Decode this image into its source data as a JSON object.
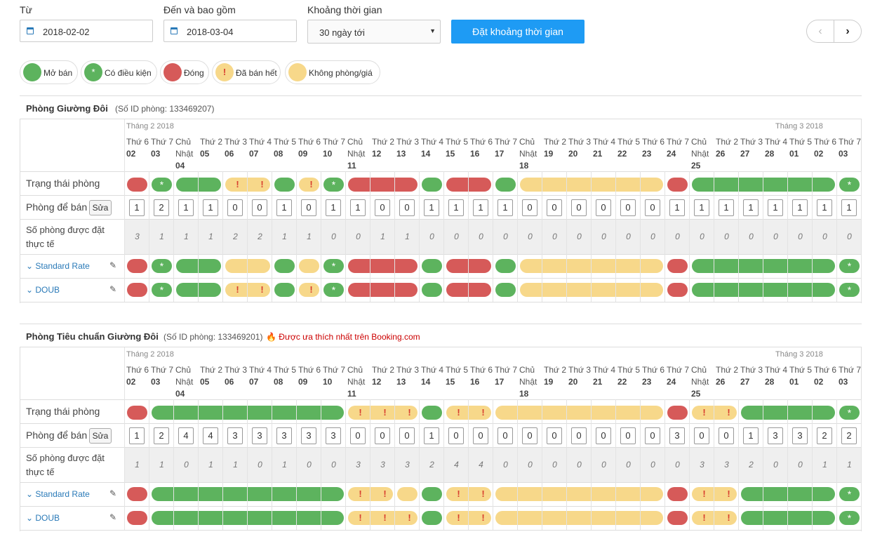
{
  "filters": {
    "from_label": "Từ",
    "from_value": "2018-02-02",
    "to_label": "Đến và bao gồm",
    "to_value": "2018-03-04",
    "period_label": "Khoảng thời gian",
    "period_value": "30 ngày tới",
    "set_button": "Đặt khoảng thời gian"
  },
  "legend": [
    {
      "label": "Mở bán",
      "color": "#5db35e",
      "symbol": ""
    },
    {
      "label": "Có điều kiện",
      "color": "#5db35e",
      "symbol": "*"
    },
    {
      "label": "Đóng",
      "color": "#d65a59",
      "symbol": ""
    },
    {
      "label": "Đã bán hết",
      "color": "#f7d88a",
      "symbol": "!"
    },
    {
      "label": "Không phòng/giá",
      "color": "#f7d88a",
      "symbol": ""
    }
  ],
  "colors": {
    "open": "#5db35e",
    "closed": "#d65a59",
    "soldout": "#f7d88a",
    "accent": "#1e9bf4"
  },
  "calendar": {
    "month_feb": "Tháng 2 2018",
    "month_mar": "Tháng 3 2018",
    "days": [
      {
        "dow": "Thứ 6",
        "d": "02"
      },
      {
        "dow": "Thứ 7",
        "d": "03"
      },
      {
        "dow": "Chủ Nhật",
        "d": "04"
      },
      {
        "dow": "Thứ 2",
        "d": "05"
      },
      {
        "dow": "Thứ 3",
        "d": "06"
      },
      {
        "dow": "Thứ 4",
        "d": "07"
      },
      {
        "dow": "Thứ 5",
        "d": "08"
      },
      {
        "dow": "Thứ 6",
        "d": "09"
      },
      {
        "dow": "Thứ 7",
        "d": "10"
      },
      {
        "dow": "Chủ Nhật",
        "d": "11"
      },
      {
        "dow": "Thứ 2",
        "d": "12"
      },
      {
        "dow": "Thứ 3",
        "d": "13"
      },
      {
        "dow": "Thứ 4",
        "d": "14"
      },
      {
        "dow": "Thứ 5",
        "d": "15"
      },
      {
        "dow": "Thứ 6",
        "d": "16"
      },
      {
        "dow": "Thứ 7",
        "d": "17"
      },
      {
        "dow": "Chủ Nhật",
        "d": "18"
      },
      {
        "dow": "Thứ 2",
        "d": "19"
      },
      {
        "dow": "Thứ 3",
        "d": "20"
      },
      {
        "dow": "Thứ 4",
        "d": "21"
      },
      {
        "dow": "Thứ 5",
        "d": "22"
      },
      {
        "dow": "Thứ 6",
        "d": "23"
      },
      {
        "dow": "Thứ 7",
        "d": "24"
      },
      {
        "dow": "Chủ Nhật",
        "d": "25"
      },
      {
        "dow": "Thứ 2",
        "d": "26"
      },
      {
        "dow": "Thứ 3",
        "d": "27"
      },
      {
        "dow": "Thứ 4",
        "d": "28"
      },
      {
        "dow": "Thứ 5",
        "d": "01"
      },
      {
        "dow": "Thứ 6",
        "d": "02"
      },
      {
        "dow": "Thứ 7",
        "d": "03"
      }
    ]
  },
  "row_labels": {
    "status": "Trạng thái phòng",
    "to_sell": "Phòng để bán",
    "edit": "Sửa",
    "booked": "Số phòng được đặt thực tế"
  },
  "rooms": [
    {
      "name": "Phòng Giường Đôi",
      "id_text": "(Số ID phòng: 133469207)",
      "favorite": "",
      "status": [
        "closed",
        "cond",
        "open",
        "open",
        "sold",
        "sold",
        "open",
        "sold",
        "cond",
        "closed",
        "closed",
        "closed",
        "open",
        "closed",
        "closed",
        "open",
        "noprice",
        "noprice",
        "noprice",
        "noprice",
        "noprice",
        "noprice",
        "closed",
        "open",
        "open",
        "open",
        "open",
        "open",
        "open",
        "cond"
      ],
      "to_sell": [
        "1",
        "2",
        "1",
        "1",
        "0",
        "0",
        "1",
        "0",
        "1",
        "1",
        "0",
        "0",
        "1",
        "1",
        "1",
        "1",
        "0",
        "0",
        "0",
        "0",
        "0",
        "0",
        "1",
        "1",
        "1",
        "1",
        "1",
        "1",
        "1",
        "1"
      ],
      "booked": [
        "3",
        "1",
        "1",
        "1",
        "2",
        "2",
        "1",
        "1",
        "0",
        "0",
        "1",
        "1",
        "0",
        "0",
        "0",
        "0",
        "0",
        "0",
        "0",
        "0",
        "0",
        "0",
        "0",
        "0",
        "0",
        "0",
        "0",
        "0",
        "0",
        "0"
      ],
      "rates": [
        {
          "name": "Standard Rate",
          "status": [
            "closed",
            "cond",
            "open",
            "open",
            "noprice",
            "noprice",
            "open",
            "noprice",
            "cond",
            "closed",
            "closed",
            "closed",
            "open",
            "closed",
            "closed",
            "open",
            "noprice",
            "noprice",
            "noprice",
            "noprice",
            "noprice",
            "noprice",
            "closed",
            "open",
            "open",
            "open",
            "open",
            "open",
            "open",
            "cond"
          ]
        },
        {
          "name": "DOUB",
          "status": [
            "closed",
            "cond",
            "open",
            "open",
            "sold",
            "sold",
            "open",
            "sold",
            "cond",
            "closed",
            "closed",
            "closed",
            "open",
            "closed",
            "closed",
            "open",
            "noprice",
            "noprice",
            "noprice",
            "noprice",
            "noprice",
            "noprice",
            "closed",
            "open",
            "open",
            "open",
            "open",
            "open",
            "open",
            "cond"
          ]
        }
      ]
    },
    {
      "name": "Phòng Tiêu chuẩn Giường Đôi",
      "id_text": "(Số ID phòng: 133469201)",
      "favorite": "Được ưa thích nhất trên Booking.com",
      "status": [
        "closed",
        "open",
        "open",
        "open",
        "open",
        "open",
        "open",
        "open",
        "open",
        "sold",
        "sold",
        "sold",
        "open",
        "sold",
        "sold",
        "noprice",
        "noprice",
        "noprice",
        "noprice",
        "noprice",
        "noprice",
        "noprice",
        "closed",
        "sold",
        "sold",
        "open",
        "open",
        "open",
        "open",
        "cond"
      ],
      "to_sell": [
        "1",
        "2",
        "4",
        "4",
        "3",
        "3",
        "3",
        "3",
        "3",
        "0",
        "0",
        "0",
        "1",
        "0",
        "0",
        "0",
        "0",
        "0",
        "0",
        "0",
        "0",
        "0",
        "3",
        "0",
        "0",
        "1",
        "3",
        "3",
        "2",
        "2"
      ],
      "booked": [
        "1",
        "1",
        "0",
        "1",
        "1",
        "0",
        "1",
        "0",
        "0",
        "3",
        "3",
        "3",
        "2",
        "4",
        "4",
        "0",
        "0",
        "0",
        "0",
        "0",
        "0",
        "0",
        "0",
        "3",
        "3",
        "2",
        "0",
        "0",
        "1",
        "1"
      ],
      "rates": [
        {
          "name": "Standard Rate",
          "status": [
            "closed",
            "open",
            "open",
            "open",
            "open",
            "open",
            "open",
            "open",
            "open",
            "sold",
            "sold",
            "noprice",
            "open",
            "sold",
            "sold",
            "noprice",
            "noprice",
            "noprice",
            "noprice",
            "noprice",
            "noprice",
            "noprice",
            "closed",
            "sold",
            "sold",
            "open",
            "open",
            "open",
            "open",
            "cond"
          ]
        },
        {
          "name": "DOUB",
          "status": [
            "closed",
            "open",
            "open",
            "open",
            "open",
            "open",
            "open",
            "open",
            "open",
            "sold",
            "sold",
            "sold",
            "open",
            "sold",
            "sold",
            "noprice",
            "noprice",
            "noprice",
            "noprice",
            "noprice",
            "noprice",
            "noprice",
            "closed",
            "sold",
            "sold",
            "open",
            "open",
            "open",
            "open",
            "cond"
          ]
        }
      ]
    }
  ]
}
